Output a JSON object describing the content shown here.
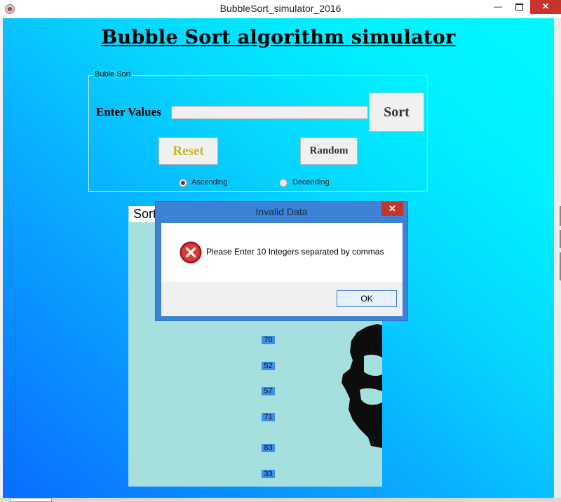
{
  "window": {
    "title": "BubbleSort_simulator_2016",
    "min_glyph": "—",
    "close_glyph": "✕"
  },
  "main": {
    "heading": "Bubble Sort algorithm simulator",
    "group_label": "Buble Sort",
    "enter_label": "Enter Values",
    "values_input": "",
    "sort_button": "Sort",
    "reset_button": "Reset",
    "random_button": "Random",
    "radio_ascending": "Ascending",
    "radio_descending": "Decending",
    "selected_order": "ascending"
  },
  "sort_panel": {
    "title": "Sort",
    "numbers": [
      "70",
      "52",
      "57",
      "71",
      "83",
      "33"
    ]
  },
  "dialog": {
    "title": "Invalid Data",
    "message": "Please Enter 10 Integers separated by commas",
    "ok_button": "OK",
    "close_glyph": "✕"
  },
  "colors": {
    "close_red": "#c7342c",
    "dialog_frame": "#3c82d6",
    "reset_text": "#c9b61a",
    "number_chip": "#3f8fe8",
    "panel_bg": "#a6e0de"
  },
  "icons": {
    "app": "app-icon",
    "error": "error-icon"
  }
}
